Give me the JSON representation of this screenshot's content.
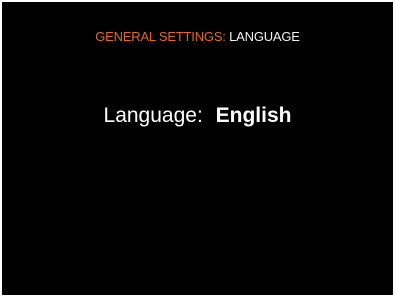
{
  "header": {
    "section": "GENERAL SETTINGS:",
    "page": "LANGUAGE"
  },
  "setting": {
    "label": "Language:",
    "value": "English"
  },
  "colors": {
    "background": "#000000",
    "section_accent": "#e0692c",
    "text": "#ffffff"
  }
}
